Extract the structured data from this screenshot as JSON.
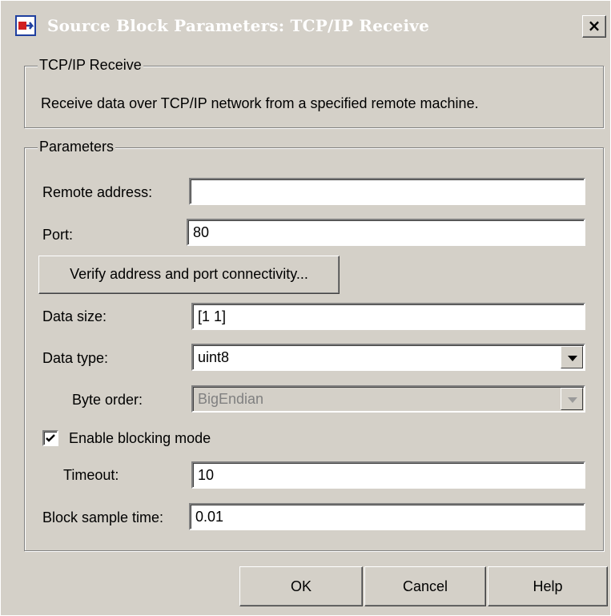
{
  "window": {
    "title": "Source Block Parameters: TCP/IP Receive",
    "close_label": "×"
  },
  "description": {
    "legend": "TCP/IP Receive",
    "text": "Receive data over TCP/IP network from a specified remote machine."
  },
  "parameters": {
    "legend": "Parameters",
    "remote_address": {
      "label": "Remote address:",
      "value": ""
    },
    "port": {
      "label": "Port:",
      "value": "80"
    },
    "verify_button": "Verify address and port connectivity...",
    "data_size": {
      "label": "Data size:",
      "value": "[1 1]"
    },
    "data_type": {
      "label": "Data type:",
      "value": "uint8"
    },
    "byte_order": {
      "label": "Byte order:",
      "value": "BigEndian",
      "enabled": false
    },
    "enable_blocking": {
      "label": "Enable blocking mode",
      "checked": true
    },
    "timeout": {
      "label": "Timeout:",
      "value": "10"
    },
    "sample_time": {
      "label": "Block sample time:",
      "value": "0.01"
    }
  },
  "buttons": {
    "ok": "OK",
    "cancel": "Cancel",
    "help": "Help"
  },
  "icons": {
    "app": "simulink-block-icon",
    "close": "close-icon",
    "dropdown": "chevron-down-icon",
    "check": "checkmark-icon"
  }
}
